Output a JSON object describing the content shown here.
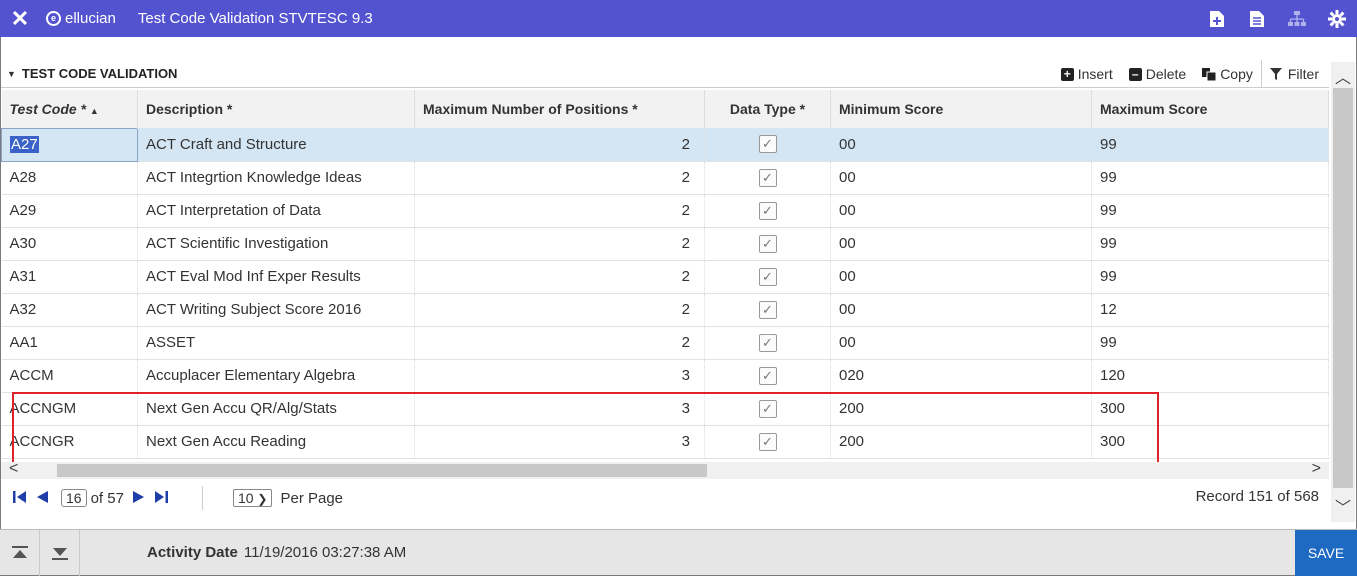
{
  "header": {
    "close_icon": "close-icon",
    "brand": "ellucian",
    "app_title": "Test Code Validation STVTESC 9.3",
    "icons": [
      "add-document-icon",
      "document-icon",
      "sitemap-icon",
      "gear-icon"
    ],
    "bar_color": "#5353d0"
  },
  "section": {
    "title": "TEST CODE VALIDATION",
    "actions": {
      "insert": "Insert",
      "delete": "Delete",
      "copy": "Copy",
      "filter": "Filter"
    }
  },
  "table": {
    "columns": {
      "test_code": "Test Code *",
      "description": "Description *",
      "max_positions": "Maximum Number of Positions *",
      "data_type": "Data Type *",
      "min_score": "Minimum Score",
      "max_score": "Maximum Score"
    },
    "rows": [
      {
        "code": "A27",
        "description": "ACT Craft and Structure",
        "positions": "2",
        "data_type": true,
        "min": "00",
        "max": "99"
      },
      {
        "code": "A28",
        "description": "ACT Integrtion Knowledge Ideas",
        "positions": "2",
        "data_type": true,
        "min": "00",
        "max": "99"
      },
      {
        "code": "A29",
        "description": "ACT Interpretation of Data",
        "positions": "2",
        "data_type": true,
        "min": "00",
        "max": "99"
      },
      {
        "code": "A30",
        "description": "ACT Scientific Investigation",
        "positions": "2",
        "data_type": true,
        "min": "00",
        "max": "99"
      },
      {
        "code": "A31",
        "description": "ACT Eval Mod Inf Exper Results",
        "positions": "2",
        "data_type": true,
        "min": "00",
        "max": "99"
      },
      {
        "code": "A32",
        "description": "ACT Writing Subject Score 2016",
        "positions": "2",
        "data_type": true,
        "min": "00",
        "max": "12"
      },
      {
        "code": "AA1",
        "description": "ASSET",
        "positions": "2",
        "data_type": true,
        "min": "00",
        "max": "99"
      },
      {
        "code": "ACCM",
        "description": "Accuplacer Elementary Algebra",
        "positions": "3",
        "data_type": true,
        "min": "020",
        "max": "120"
      },
      {
        "code": "ACCNGM",
        "description": "Next Gen Accu QR/Alg/Stats",
        "positions": "3",
        "data_type": true,
        "min": "200",
        "max": "300"
      },
      {
        "code": "ACCNGR",
        "description": "Next Gen Accu Reading",
        "positions": "3",
        "data_type": true,
        "min": "200",
        "max": "300"
      }
    ]
  },
  "pager": {
    "page": "16",
    "of_pages": "of 57",
    "per_page_value": "10",
    "per_page_label": "Per Page",
    "record": "Record 151 of 568"
  },
  "footer": {
    "activity_label": "Activity Date",
    "activity_value": "11/19/2016 03:27:38 AM",
    "save_label": "SAVE"
  }
}
